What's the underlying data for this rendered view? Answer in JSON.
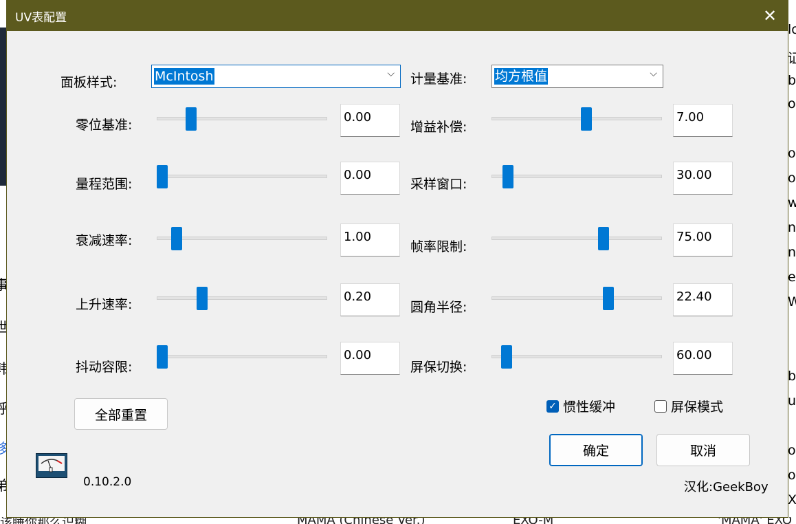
{
  "window": {
    "title": "UV表配置",
    "close_glyph": "✕"
  },
  "dropdowns": {
    "panel_style": {
      "label": "面板样式:",
      "value": "McIntosh"
    },
    "metering": {
      "label": "计量基准:",
      "value": "均方根值"
    }
  },
  "sliders_left": [
    {
      "label": "零位基准:",
      "value": "0.00",
      "level": 0.18
    },
    {
      "label": "量程范围:",
      "value": "0.00",
      "level": 0.0
    },
    {
      "label": "衰减速率:",
      "value": "1.00",
      "level": 0.09
    },
    {
      "label": "上升速率:",
      "value": "0.20",
      "level": 0.25
    },
    {
      "label": "抖动容限:",
      "value": "0.00",
      "level": 0.0
    }
  ],
  "sliders_right": [
    {
      "label": "增益补偿:",
      "value": "7.00",
      "level": 0.56
    },
    {
      "label": "采样窗口:",
      "value": "30.00",
      "level": 0.07
    },
    {
      "label": "帧率限制:",
      "value": "75.00",
      "level": 0.67
    },
    {
      "label": "圆角半径:",
      "value": "22.40",
      "level": 0.7
    },
    {
      "label": "屏保切换:",
      "value": "60.00",
      "level": 0.06
    }
  ],
  "buttons": {
    "reset_all": "全部重置",
    "ok": "确定",
    "cancel": "取消"
  },
  "checkboxes": {
    "inertia_buffer": {
      "label": "惯性缓冲",
      "checked": true,
      "mark": "✓"
    },
    "screensaver_mode": {
      "label": "屏保模式",
      "checked": false
    }
  },
  "footer": {
    "version": "0.10.2.0",
    "credit": "汉化:GeekBoy",
    "app_icon": "vu-meter-icon"
  },
  "background": {
    "right_fragments": [
      "lo",
      "证",
      "b",
      "o",
      "o",
      "o",
      "w",
      "n",
      "n",
      "e",
      "W",
      "b",
      "u",
      "o",
      "o",
      "X",
      "EXO"
    ],
    "left_fragments": [
      "事",
      "世",
      "韩",
      "呼",
      "移",
      "弟"
    ],
    "bottom_fragments": [
      "该睡你那么识糊",
      "MAMA (Chinese Ver.)",
      "EXO-M",
      "'MAMA' EXO"
    ]
  }
}
